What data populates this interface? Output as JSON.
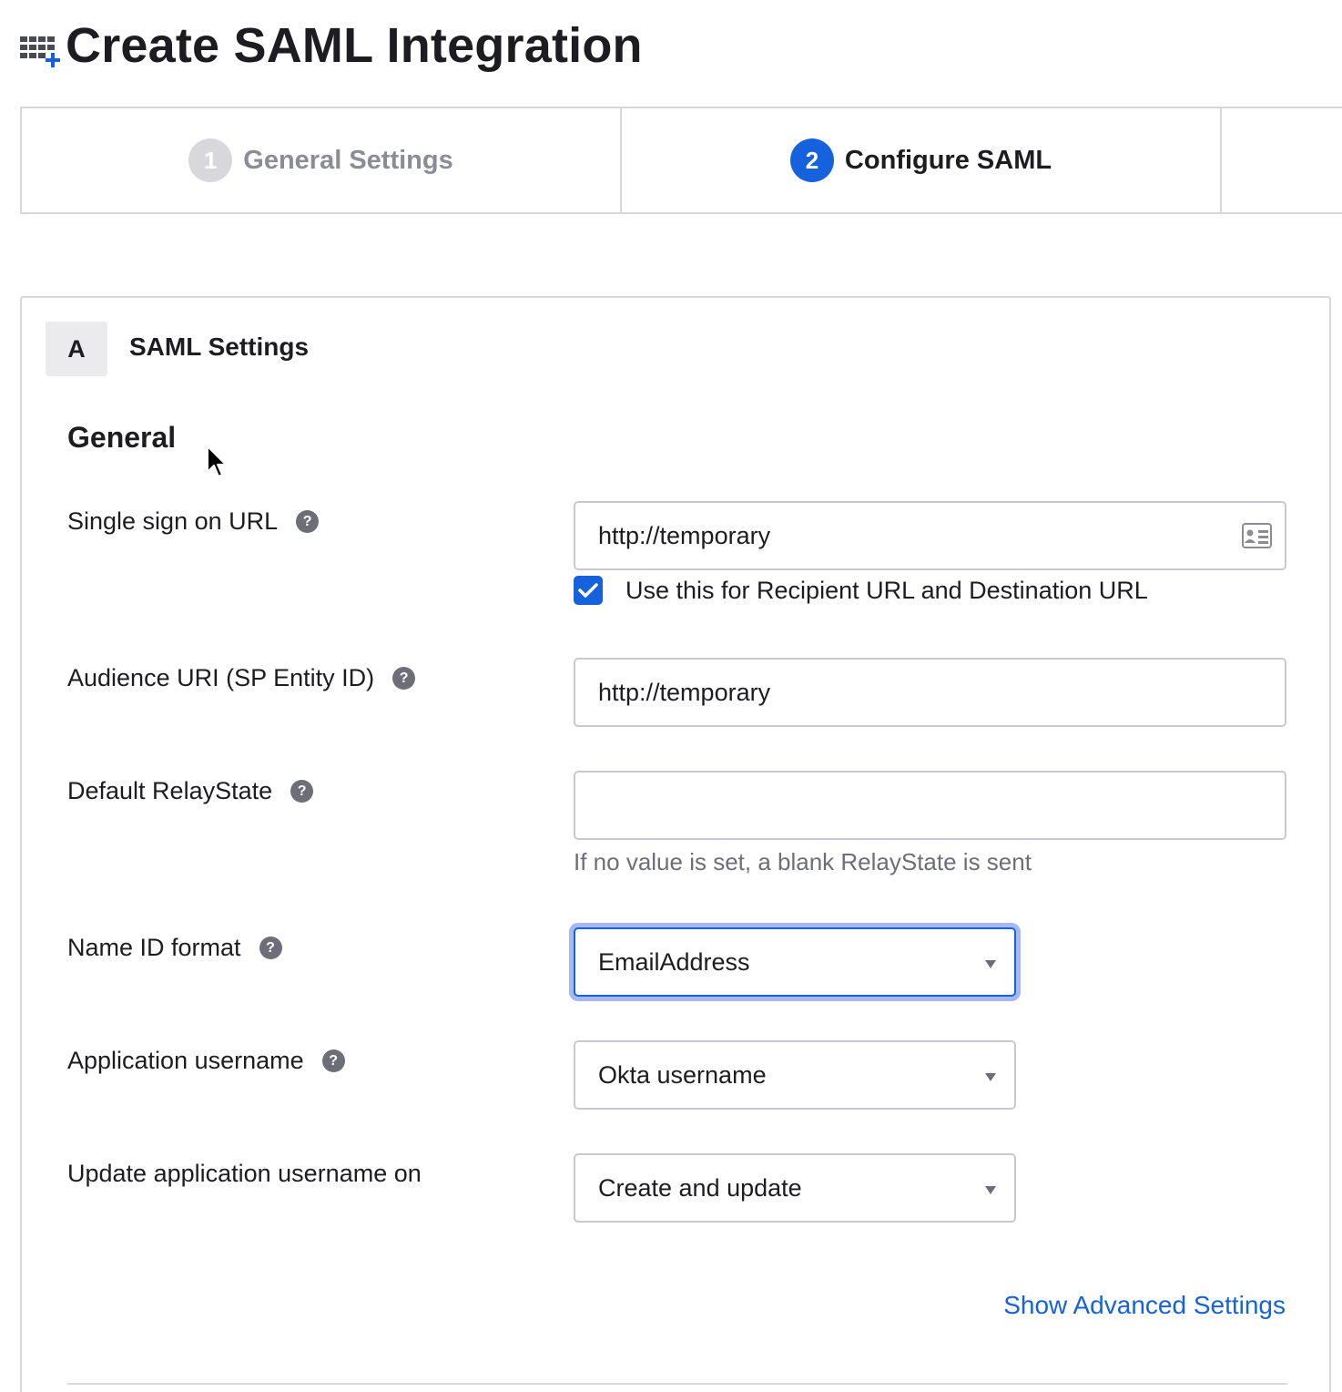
{
  "page": {
    "title": "Create SAML Integration",
    "icon": "app-add-icon"
  },
  "steps": [
    {
      "number": "1",
      "label": "General Settings",
      "state": "inactive"
    },
    {
      "number": "2",
      "label": "Configure SAML",
      "state": "active"
    }
  ],
  "section": {
    "badge": "A",
    "title": "SAML Settings",
    "group_title": "General"
  },
  "fields": {
    "sso_url": {
      "label": "Single sign on URL",
      "value": "http://temporary",
      "icon": "contact-card-icon",
      "checkbox_label": "Use this for Recipient URL and Destination URL",
      "checkbox_checked": true
    },
    "audience_uri": {
      "label": "Audience URI (SP Entity ID)",
      "value": "http://temporary"
    },
    "relay_state": {
      "label": "Default RelayState",
      "value": "",
      "help_text": "If no value is set, a blank RelayState is sent"
    },
    "name_id_format": {
      "label": "Name ID format",
      "selected": "EmailAddress"
    },
    "app_username": {
      "label": "Application username",
      "selected": "Okta username"
    },
    "update_username_on": {
      "label": "Update application username on",
      "selected": "Create and update"
    }
  },
  "help_glyph": "?",
  "advanced_link": "Show Advanced Settings",
  "colors": {
    "accent": "#1662dd",
    "focus_ring": "#a6b8f0",
    "border": "#d7d7dc",
    "muted_text": "#6e6e78"
  }
}
